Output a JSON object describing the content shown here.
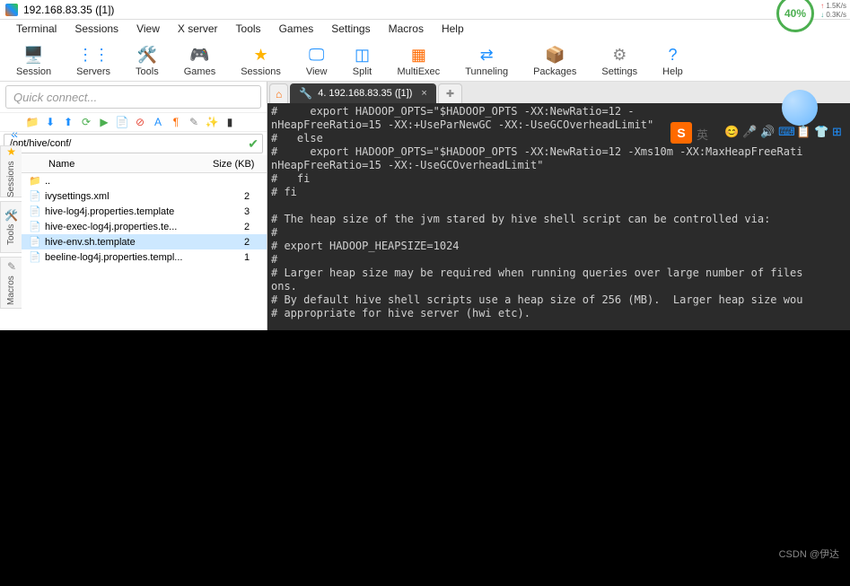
{
  "window": {
    "title": "192.168.83.35 ([1])"
  },
  "cpu_badge": "40%",
  "net": {
    "up": "1.5K/s",
    "down": "0.3K/s"
  },
  "menus": [
    "Terminal",
    "Sessions",
    "View",
    "X server",
    "Tools",
    "Games",
    "Settings",
    "Macros",
    "Help"
  ],
  "toolbar": [
    {
      "label": "Session",
      "icon": "🖥️",
      "color": "#1e90ff"
    },
    {
      "label": "Servers",
      "icon": "⋮⋮",
      "color": "#1e90ff"
    },
    {
      "label": "Tools",
      "icon": "🛠️",
      "color": "#ff6a00"
    },
    {
      "label": "Games",
      "icon": "🎮",
      "color": "#888"
    },
    {
      "label": "Sessions",
      "icon": "★",
      "color": "#ffb400"
    },
    {
      "label": "View",
      "icon": "🖵",
      "color": "#1e90ff"
    },
    {
      "label": "Split",
      "icon": "◫",
      "color": "#1e90ff"
    },
    {
      "label": "MultiExec",
      "icon": "▦",
      "color": "#ff6a00"
    },
    {
      "label": "Tunneling",
      "icon": "⇄",
      "color": "#1e90ff"
    },
    {
      "label": "Packages",
      "icon": "📦",
      "color": "#c9a55a"
    },
    {
      "label": "Settings",
      "icon": "⚙",
      "color": "#888"
    },
    {
      "label": "Help",
      "icon": "?",
      "color": "#1e90ff"
    }
  ],
  "quick_connect_placeholder": "Quick connect...",
  "sogou_label": "英",
  "path": "/opt/hive/conf/",
  "file_cols": {
    "name": "Name",
    "size": "Size (KB)"
  },
  "files": [
    {
      "name": "..",
      "size": "",
      "icon": "📁",
      "cls": "folder-ico"
    },
    {
      "name": "ivysettings.xml",
      "size": "2",
      "icon": "📄",
      "cls": "file-ico"
    },
    {
      "name": "hive-log4j.properties.template",
      "size": "3",
      "icon": "📄",
      "cls": "file-ico"
    },
    {
      "name": "hive-exec-log4j.properties.te...",
      "size": "2",
      "icon": "📄",
      "cls": "file-ico"
    },
    {
      "name": "hive-env.sh.template",
      "size": "2",
      "icon": "📄",
      "cls": "file-ico"
    },
    {
      "name": "beeline-log4j.properties.templ...",
      "size": "1",
      "icon": "📄",
      "cls": "file-ico"
    }
  ],
  "selected_file_index": 4,
  "side_tabs": [
    {
      "label": "Sessions",
      "icon": "★",
      "color": "#ffb400"
    },
    {
      "label": "Tools",
      "icon": "🛠️",
      "color": "#ff6a00"
    },
    {
      "label": "Macros",
      "icon": "✎",
      "color": "#888"
    }
  ],
  "tabs": {
    "home_icon": "⌂",
    "active": {
      "icon": "🔧",
      "label": "4. 192.168.83.35 ([1])"
    },
    "new_icon": "✚"
  },
  "terminal_text": "#     export HADOOP_OPTS=\"$HADOOP_OPTS -XX:NewRatio=12 -\nnHeapFreeRatio=15 -XX:+UseParNewGC -XX:-UseGCOverheadLimit\"\n#   else\n#     export HADOOP_OPTS=\"$HADOOP_OPTS -XX:NewRatio=12 -Xms10m -XX:MaxHeapFreeRati\nnHeapFreeRatio=15 -XX:-UseGCOverheadLimit\"\n#   fi\n# fi\n\n# The heap size of the jvm stared by hive shell script can be controlled via:\n#\n# export HADOOP_HEAPSIZE=1024\n#\n# Larger heap size may be required when running queries over large number of files\nons.\n# By default hive shell scripts use a heap size of 256 (MB).  Larger heap size wou\n# appropriate for hive server (hwi etc).",
  "watermark": "CSDN @伊达",
  "right_icons": [
    "😊",
    "🎤",
    "🔊",
    "⌨",
    "📋",
    "👕",
    "⊞"
  ]
}
